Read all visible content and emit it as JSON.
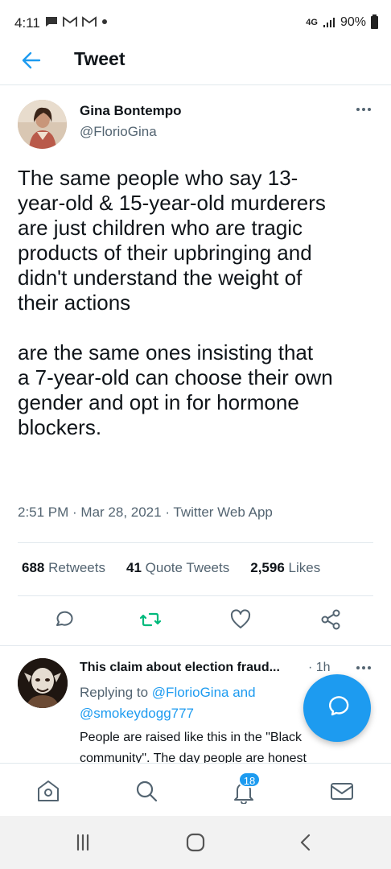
{
  "status_bar": {
    "time": "4:11",
    "notif_icons": [
      "chat-icon",
      "gmail-icon",
      "gmail-icon",
      "dot-icon"
    ],
    "network": "4G",
    "battery": "90%"
  },
  "header": {
    "title": "Tweet"
  },
  "tweet": {
    "author_name": "Gina Bontempo",
    "author_handle": "@FlorioGina",
    "text": "The same people who say 13-\nyear-old & 15-year-old murderers\nare just children who are tragic\nproducts of their upbringing and\ndidn't understand the weight of\ntheir actions\n\nare the same ones insisting that\na 7-year-old can choose their own\ngender and opt in for hormone\nblockers.",
    "meta": "2:51 PM · Mar 28, 2021 · Twitter Web App",
    "stats": {
      "retweets_count": "688",
      "retweets_label": "Retweets",
      "quotes_count": "41",
      "quotes_label": "Quote Tweets",
      "likes_count": "2,596",
      "likes_label": "Likes"
    }
  },
  "reply": {
    "name": "This claim about election fraud...",
    "time": "· 1h",
    "replying_prefix": "Replying to",
    "replying_first": "@FlorioGina and",
    "replying_second": "@smokeydogg777",
    "text": "People are raised like this in the \"Black community\". The day people are honest"
  },
  "bottom_nav": {
    "notification_badge": "18"
  },
  "colors": {
    "accent": "#1d9bf0",
    "retweet_green": "#00ba7c",
    "secondary_text": "#536471"
  }
}
